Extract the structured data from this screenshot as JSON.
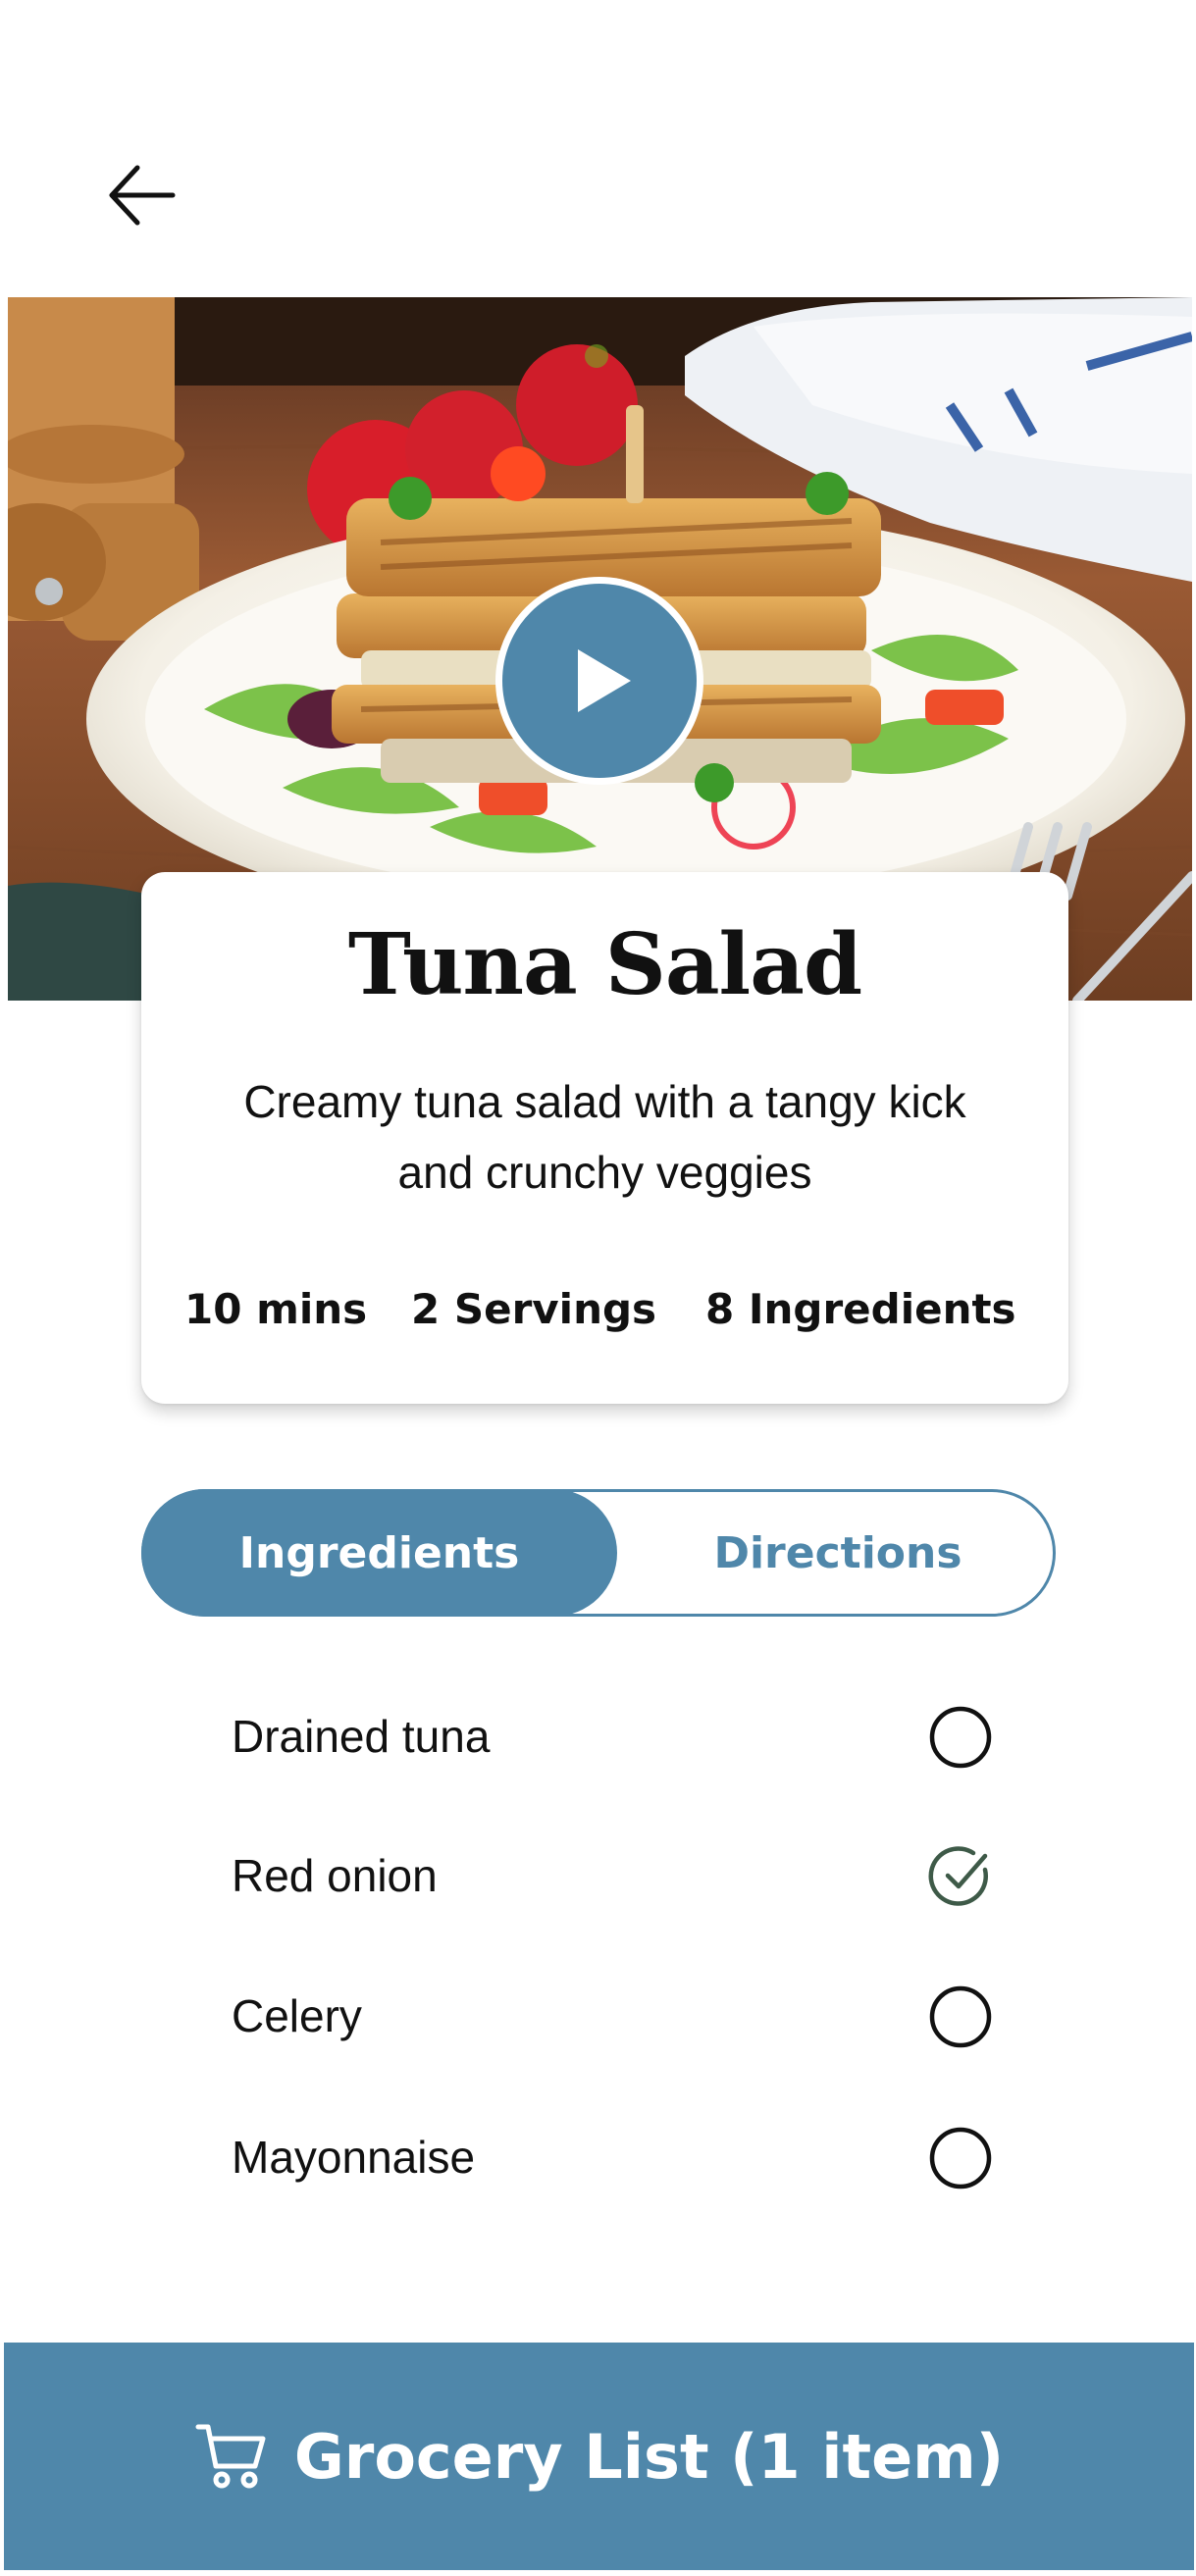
{
  "header": {
    "back_icon": "arrow-left-icon"
  },
  "hero": {
    "play_icon": "play-icon",
    "accent_color": "#4f87aa"
  },
  "recipe": {
    "title": "Tuna Salad",
    "description": "Creamy tuna salad with a tangy kick and crunchy veggies",
    "time": "10 mins",
    "servings": "2 Servings",
    "ingredients_count": "8 Ingredients"
  },
  "tabs": {
    "items": [
      {
        "label": "Ingredients",
        "active": true
      },
      {
        "label": "Directions",
        "active": false
      }
    ]
  },
  "ingredients": [
    {
      "name": "Drained tuna",
      "checked": false
    },
    {
      "name": "Red onion",
      "checked": true
    },
    {
      "name": "Celery",
      "checked": false
    },
    {
      "name": "Mayonnaise",
      "checked": false
    }
  ],
  "grocery": {
    "label": "Grocery List (1 item)",
    "icon": "cart-icon"
  },
  "colors": {
    "primary": "#4f87aa",
    "checked": "#3e5a48",
    "text": "#111111"
  }
}
